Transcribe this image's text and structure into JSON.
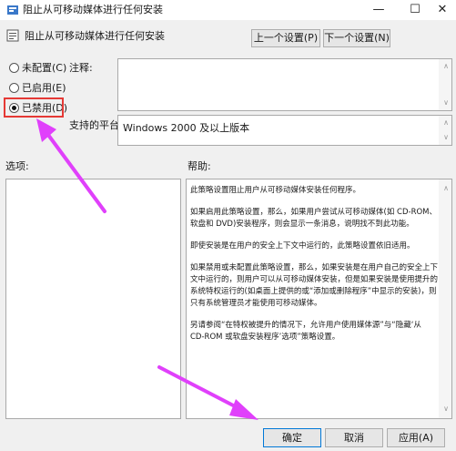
{
  "window": {
    "title": "阻止从可移动媒体进行任何安装",
    "minimize": "—",
    "maximize": "☐",
    "close": "✕"
  },
  "header": {
    "policy_name": "阻止从可移动媒体进行任何安装",
    "prev_button": "上一个设置(P)",
    "next_button": "下一个设置(N)"
  },
  "state": {
    "options": [
      {
        "label": "未配置(C)",
        "selected": false
      },
      {
        "label": "已启用(E)",
        "selected": false
      },
      {
        "label": "已禁用(D)",
        "selected": true
      }
    ]
  },
  "comment": {
    "label": "注释:",
    "value": ""
  },
  "supported": {
    "label": "支持的平台:",
    "value": "Windows 2000 及以上版本"
  },
  "options_panel": {
    "label": "选项:"
  },
  "help_panel": {
    "label": "帮助:",
    "paragraphs": [
      "此策略设置阻止用户从可移动媒体安装任何程序。",
      "如果启用此策略设置，那么，如果用户尝试从可移动媒体(如 CD-ROM、软盘和 DVD)安装程序，则会显示一条消息，说明找不到此功能。",
      "即使安装是在用户的安全上下文中运行的，此策略设置依旧适用。",
      "如果禁用或未配置此策略设置，那么，如果安装是在用户自己的安全上下文中运行的，则用户可以从可移动媒体安装，但是如果安装是使用提升的系统特权运行的(如桌面上提供的或“添加或删除程序”中显示的安装)，则只有系统管理员才能使用可移动媒体。",
      "另请参阅“在特权被提升的情况下，允许用户使用媒体源”与“隐藏‘从 CD-ROM 或软盘安装程序’选项”策略设置。"
    ]
  },
  "footer": {
    "ok": "确定",
    "cancel": "取消",
    "apply": "应用(A)"
  },
  "colors": {
    "annotation_highlight": "#e53935",
    "annotation_arrow": "#e040fb"
  }
}
